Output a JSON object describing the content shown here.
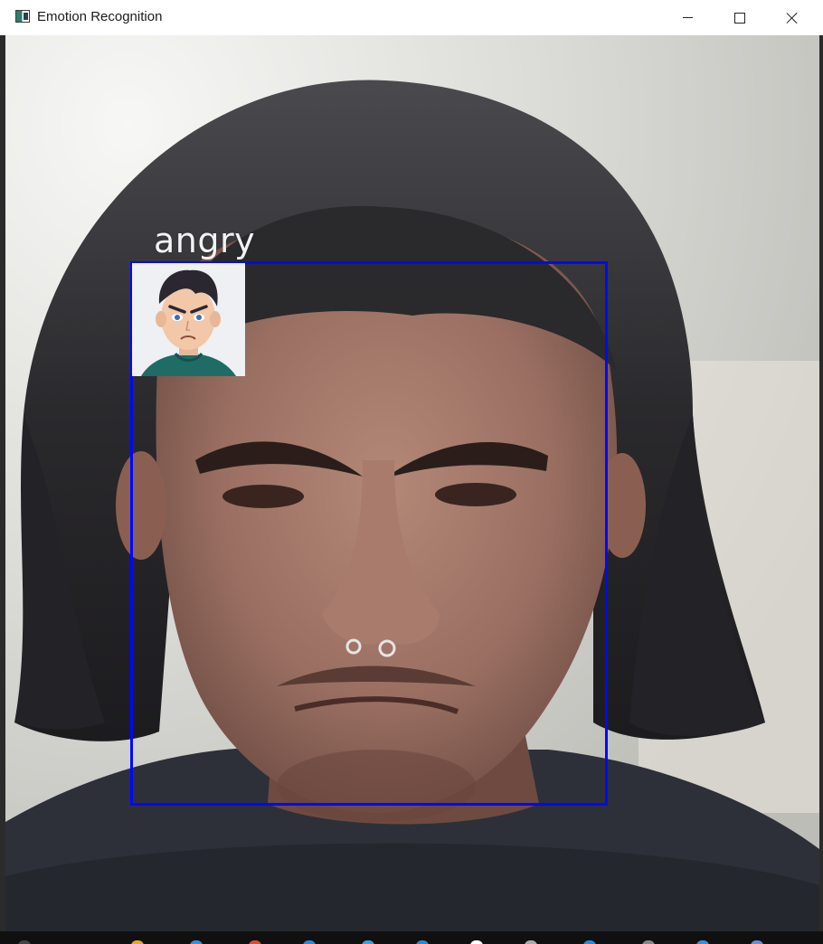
{
  "window": {
    "title": "Emotion Recognition"
  },
  "detection": {
    "emotion_label": "angry",
    "box_color": "#0008ff",
    "label_color": "#f2f2f2"
  },
  "avatar": {
    "icon": "angry-cartoon-boy-avatar"
  },
  "icons": {
    "app": "python-window-icon",
    "minimize": "minimize-icon",
    "maximize": "maximize-icon",
    "close": "close-icon"
  }
}
